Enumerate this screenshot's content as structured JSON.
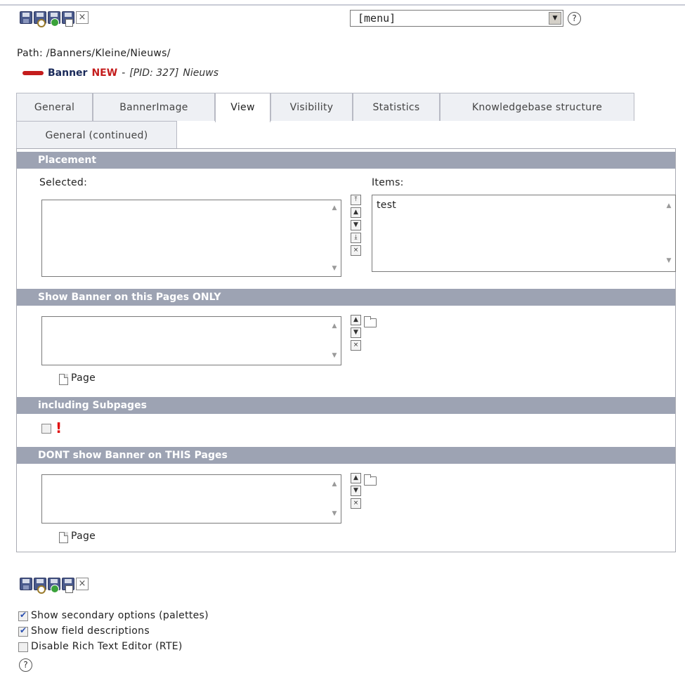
{
  "toolbar": {
    "icons": [
      "save-icon",
      "save-and-view-icon",
      "save-and-new-icon",
      "save-and-close-icon",
      "close-icon"
    ]
  },
  "menu": {
    "value": "[menu]"
  },
  "help": {
    "symbol": "?"
  },
  "path": {
    "text": "Path: /Banners/Kleine/Nieuws/"
  },
  "record": {
    "type": "Banner",
    "status": "NEW",
    "dash": "-",
    "pid": "[PID: 327]",
    "page": "Nieuws"
  },
  "tabs": [
    {
      "label": "General"
    },
    {
      "label": "BannerImage"
    },
    {
      "label": "View",
      "active": true
    },
    {
      "label": "Visibility"
    },
    {
      "label": "Statistics"
    },
    {
      "label": "Knowledgebase structure"
    },
    {
      "label": "General (continued)"
    }
  ],
  "sections": {
    "placement": {
      "title": "Placement",
      "selected_label": "Selected:",
      "items_label": "Items:",
      "items": [
        "test"
      ]
    },
    "show_only": {
      "title": "Show Banner on this Pages ONLY",
      "page_label": "Page"
    },
    "subpages": {
      "title": "including Subpages",
      "alert": "!"
    },
    "dont_show": {
      "title": "DONT show Banner on THIS Pages",
      "page_label": "Page"
    }
  },
  "options": [
    {
      "label": "Show secondary options (palettes)",
      "checked": true
    },
    {
      "label": "Show field descriptions",
      "checked": true
    },
    {
      "label": "Disable Rich Text Editor (RTE)",
      "checked": false
    }
  ],
  "colors": {
    "section_header": "#9da3b3",
    "new_status": "#c41d1d",
    "record_title": "#1a2a5a"
  }
}
